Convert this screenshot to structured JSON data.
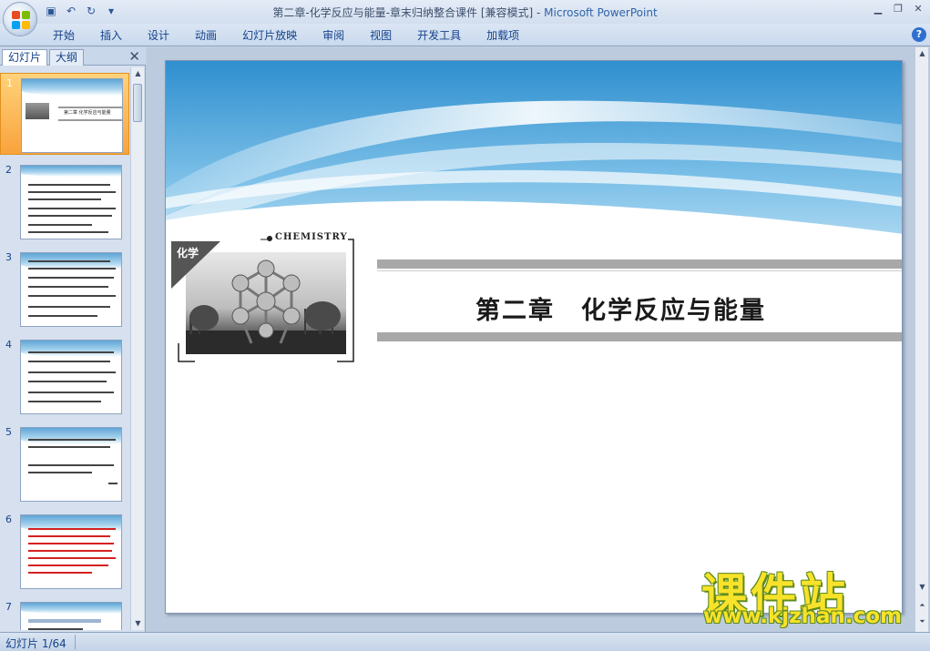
{
  "window": {
    "title": "第二章-化学反应与能量-章末归纳整合课件 [兼容模式]",
    "app_name": "Microsoft PowerPoint",
    "title_sep": " - "
  },
  "quick_access": {
    "save_icon": "save-icon",
    "undo_icon": "undo-icon",
    "redo_icon": "redo-icon",
    "customize_icon": "customize-qat-icon"
  },
  "ribbon": {
    "tabs": [
      "开始",
      "插入",
      "设计",
      "动画",
      "幻灯片放映",
      "审阅",
      "视图",
      "开发工具",
      "加载项"
    ],
    "help_icon": "?"
  },
  "left_pane": {
    "tabs": [
      "幻灯片",
      "大纲"
    ],
    "close_icon": "✕",
    "thumbnails": [
      {
        "num": "1",
        "selected": true
      },
      {
        "num": "2",
        "selected": false
      },
      {
        "num": "3",
        "selected": false
      },
      {
        "num": "4",
        "selected": false
      },
      {
        "num": "5",
        "selected": false
      },
      {
        "num": "6",
        "selected": false
      },
      {
        "num": "7",
        "selected": false
      }
    ],
    "thumb1_title": "第二章  化学反应与能量"
  },
  "slide": {
    "badge": "化学",
    "chemistry_word": "CHEMISTRY",
    "title": "第二章　化学反应与能量"
  },
  "watermark": {
    "cn": "课件站",
    "url": "www.kjzhan.com"
  },
  "status": {
    "slide_counter": "幻灯片 1/64"
  },
  "colors": {
    "selection": "#f9a33c",
    "accent": "#2f64a8",
    "watermark": "#f8e22a"
  }
}
